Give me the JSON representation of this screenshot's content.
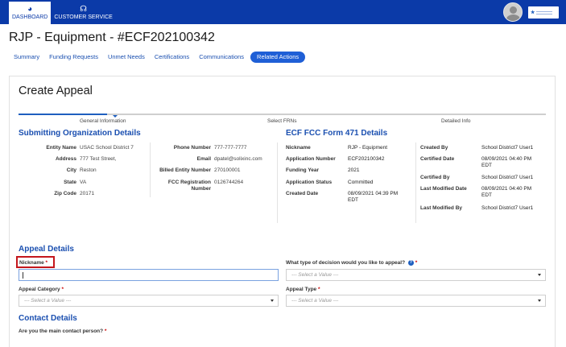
{
  "topnav": {
    "tabs": [
      {
        "label": "DASHBOARD",
        "icon": "gauge-icon"
      },
      {
        "label": "CUSTOMER SERVICE",
        "icon": "headset-icon"
      }
    ]
  },
  "page": {
    "title": "RJP - Equipment - #ECF202100342",
    "subnav": [
      "Summary",
      "Funding Requests",
      "Unmet Needs",
      "Certifications",
      "Communications",
      "Related Actions"
    ]
  },
  "panel": {
    "title": "Create Appeal",
    "steps": [
      "General Information",
      "Select FRNs",
      "Detailed Info"
    ]
  },
  "org": {
    "heading": "Submitting Organization Details",
    "left": [
      {
        "k": "Entity Name",
        "v": "USAC School District 7"
      },
      {
        "k": "Address",
        "v": "777 Test Street,"
      },
      {
        "k": "City",
        "v": "Reston"
      },
      {
        "k": "State",
        "v": "VA"
      },
      {
        "k": "Zip Code",
        "v": "20171"
      }
    ],
    "right": [
      {
        "k": "Phone Number",
        "v": "777-777-7777"
      },
      {
        "k": "Email",
        "v": "dpatel@solixinc.com"
      },
      {
        "k": "Billed Entity Number",
        "v": "270100001"
      },
      {
        "k": "FCC Registration",
        "k2": "Number",
        "v": "0126744264"
      }
    ]
  },
  "form471": {
    "heading": "ECF FCC Form 471 Details",
    "left": [
      {
        "k": "Nickname",
        "v": "RJP - Equipment"
      },
      {
        "k": "Application Number",
        "v": "ECF202100342"
      },
      {
        "k": "Funding Year",
        "v": "2021"
      },
      {
        "k": "Application Status",
        "v": "Committed"
      },
      {
        "k": "Created Date",
        "v": "08/09/2021 04:39 PM",
        "v2": "EDT"
      }
    ],
    "right": [
      {
        "k": "Created By",
        "v": "School District7 User1"
      },
      {
        "k": "Certified Date",
        "v": "08/09/2021 04:40 PM",
        "v2": "EDT"
      },
      {
        "k": "Certified By",
        "v": "School District7 User1"
      },
      {
        "k": "Last Modified Date",
        "v": "08/09/2021 04:40 PM",
        "v2": "EDT"
      },
      {
        "k": "Last Modified By",
        "v": "School District7 User1"
      }
    ]
  },
  "appeal": {
    "heading": "Appeal Details",
    "nickname_label": "Nickname",
    "nickname_value": "",
    "decision_label": "What type of decision would you like to appeal?",
    "decision_placeholder": "--- Select a Value ---",
    "category_label": "Appeal Category",
    "category_placeholder": "--- Select a Value ---",
    "type_label": "Appeal Type",
    "type_placeholder": "--- Select a Value ---",
    "required_mark": "*",
    "help_glyph": "?"
  },
  "contact": {
    "heading": "Contact Details",
    "main_contact_label": "Are you the main contact person?"
  },
  "colors": {
    "brand": "#0b3aa8",
    "link": "#1a4fb0",
    "highlight": "#c4161c"
  }
}
